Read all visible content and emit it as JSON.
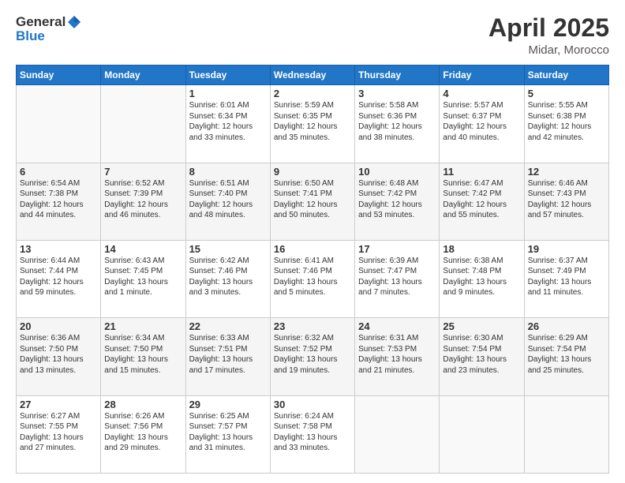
{
  "logo": {
    "general": "General",
    "blue": "Blue"
  },
  "header": {
    "month": "April 2025",
    "location": "Midar, Morocco"
  },
  "weekdays": [
    "Sunday",
    "Monday",
    "Tuesday",
    "Wednesday",
    "Thursday",
    "Friday",
    "Saturday"
  ],
  "weeks": [
    [
      {
        "day": "",
        "info": ""
      },
      {
        "day": "",
        "info": ""
      },
      {
        "day": "1",
        "info": "Sunrise: 6:01 AM\nSunset: 6:34 PM\nDaylight: 12 hours\nand 33 minutes."
      },
      {
        "day": "2",
        "info": "Sunrise: 5:59 AM\nSunset: 6:35 PM\nDaylight: 12 hours\nand 35 minutes."
      },
      {
        "day": "3",
        "info": "Sunrise: 5:58 AM\nSunset: 6:36 PM\nDaylight: 12 hours\nand 38 minutes."
      },
      {
        "day": "4",
        "info": "Sunrise: 5:57 AM\nSunset: 6:37 PM\nDaylight: 12 hours\nand 40 minutes."
      },
      {
        "day": "5",
        "info": "Sunrise: 5:55 AM\nSunset: 6:38 PM\nDaylight: 12 hours\nand 42 minutes."
      }
    ],
    [
      {
        "day": "6",
        "info": "Sunrise: 6:54 AM\nSunset: 7:38 PM\nDaylight: 12 hours\nand 44 minutes."
      },
      {
        "day": "7",
        "info": "Sunrise: 6:52 AM\nSunset: 7:39 PM\nDaylight: 12 hours\nand 46 minutes."
      },
      {
        "day": "8",
        "info": "Sunrise: 6:51 AM\nSunset: 7:40 PM\nDaylight: 12 hours\nand 48 minutes."
      },
      {
        "day": "9",
        "info": "Sunrise: 6:50 AM\nSunset: 7:41 PM\nDaylight: 12 hours\nand 50 minutes."
      },
      {
        "day": "10",
        "info": "Sunrise: 6:48 AM\nSunset: 7:42 PM\nDaylight: 12 hours\nand 53 minutes."
      },
      {
        "day": "11",
        "info": "Sunrise: 6:47 AM\nSunset: 7:42 PM\nDaylight: 12 hours\nand 55 minutes."
      },
      {
        "day": "12",
        "info": "Sunrise: 6:46 AM\nSunset: 7:43 PM\nDaylight: 12 hours\nand 57 minutes."
      }
    ],
    [
      {
        "day": "13",
        "info": "Sunrise: 6:44 AM\nSunset: 7:44 PM\nDaylight: 12 hours\nand 59 minutes."
      },
      {
        "day": "14",
        "info": "Sunrise: 6:43 AM\nSunset: 7:45 PM\nDaylight: 13 hours\nand 1 minute."
      },
      {
        "day": "15",
        "info": "Sunrise: 6:42 AM\nSunset: 7:46 PM\nDaylight: 13 hours\nand 3 minutes."
      },
      {
        "day": "16",
        "info": "Sunrise: 6:41 AM\nSunset: 7:46 PM\nDaylight: 13 hours\nand 5 minutes."
      },
      {
        "day": "17",
        "info": "Sunrise: 6:39 AM\nSunset: 7:47 PM\nDaylight: 13 hours\nand 7 minutes."
      },
      {
        "day": "18",
        "info": "Sunrise: 6:38 AM\nSunset: 7:48 PM\nDaylight: 13 hours\nand 9 minutes."
      },
      {
        "day": "19",
        "info": "Sunrise: 6:37 AM\nSunset: 7:49 PM\nDaylight: 13 hours\nand 11 minutes."
      }
    ],
    [
      {
        "day": "20",
        "info": "Sunrise: 6:36 AM\nSunset: 7:50 PM\nDaylight: 13 hours\nand 13 minutes."
      },
      {
        "day": "21",
        "info": "Sunrise: 6:34 AM\nSunset: 7:50 PM\nDaylight: 13 hours\nand 15 minutes."
      },
      {
        "day": "22",
        "info": "Sunrise: 6:33 AM\nSunset: 7:51 PM\nDaylight: 13 hours\nand 17 minutes."
      },
      {
        "day": "23",
        "info": "Sunrise: 6:32 AM\nSunset: 7:52 PM\nDaylight: 13 hours\nand 19 minutes."
      },
      {
        "day": "24",
        "info": "Sunrise: 6:31 AM\nSunset: 7:53 PM\nDaylight: 13 hours\nand 21 minutes."
      },
      {
        "day": "25",
        "info": "Sunrise: 6:30 AM\nSunset: 7:54 PM\nDaylight: 13 hours\nand 23 minutes."
      },
      {
        "day": "26",
        "info": "Sunrise: 6:29 AM\nSunset: 7:54 PM\nDaylight: 13 hours\nand 25 minutes."
      }
    ],
    [
      {
        "day": "27",
        "info": "Sunrise: 6:27 AM\nSunset: 7:55 PM\nDaylight: 13 hours\nand 27 minutes."
      },
      {
        "day": "28",
        "info": "Sunrise: 6:26 AM\nSunset: 7:56 PM\nDaylight: 13 hours\nand 29 minutes."
      },
      {
        "day": "29",
        "info": "Sunrise: 6:25 AM\nSunset: 7:57 PM\nDaylight: 13 hours\nand 31 minutes."
      },
      {
        "day": "30",
        "info": "Sunrise: 6:24 AM\nSunset: 7:58 PM\nDaylight: 13 hours\nand 33 minutes."
      },
      {
        "day": "",
        "info": ""
      },
      {
        "day": "",
        "info": ""
      },
      {
        "day": "",
        "info": ""
      }
    ]
  ]
}
